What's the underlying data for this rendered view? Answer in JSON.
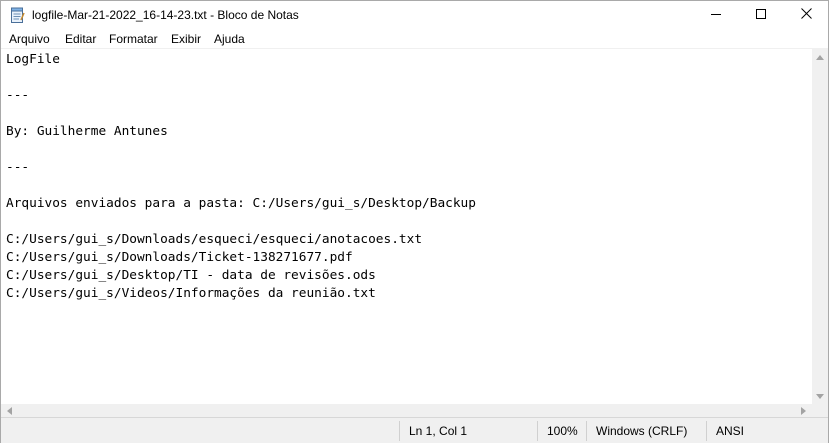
{
  "window": {
    "title": "logfile-Mar-21-2022_16-14-23.txt - Bloco de Notas",
    "icon": "notepad-icon"
  },
  "window_controls": {
    "minimize_icon": "minimize-icon",
    "maximize_icon": "maximize-icon",
    "close_icon": "close-icon"
  },
  "menu": {
    "items": [
      "Arquivo",
      "Editar",
      "Formatar",
      "Exibir",
      "Ajuda"
    ]
  },
  "document": {
    "lines": [
      "LogFile",
      "",
      "---",
      "",
      "By: Guilherme Antunes",
      "",
      "---",
      "",
      "Arquivos enviados para a pasta: C:/Users/gui_s/Desktop/Backup",
      "",
      "C:/Users/gui_s/Downloads/esqueci/esqueci/anotacoes.txt",
      "C:/Users/gui_s/Downloads/Ticket-138271677.pdf",
      "C:/Users/gui_s/Desktop/TI - data de revisões.ods",
      "C:/Users/gui_s/Videos/Informações da reunião.txt"
    ]
  },
  "status": {
    "position": "Ln 1, Col 1",
    "zoom": "100%",
    "line_ending": "Windows (CRLF)",
    "encoding": "ANSI"
  },
  "colors": {
    "statusbar_bg": "#f0f0f0",
    "scrollbar_bg": "#f0f0f0"
  }
}
